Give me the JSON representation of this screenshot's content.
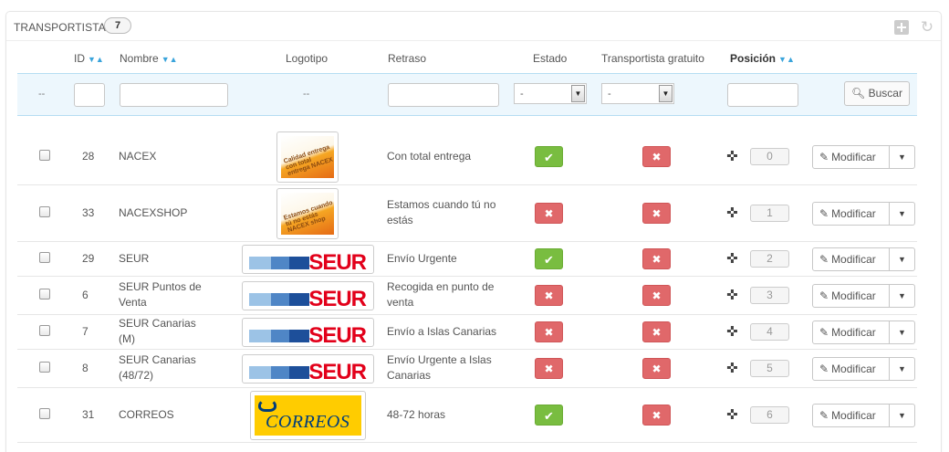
{
  "panel": {
    "title": "TRANSPORTISTAS",
    "count": "7"
  },
  "columns": {
    "id": "ID",
    "name": "Nombre",
    "logo": "Logotipo",
    "delay": "Retraso",
    "status": "Estado",
    "free": "Transportista gratuito",
    "position": "Posición"
  },
  "filters": {
    "select_empty": "--",
    "logo_empty": "--",
    "status_value": "-",
    "free_value": "-",
    "search_label": "Buscar"
  },
  "actions": {
    "edit_label": "Modificar"
  },
  "colors": {
    "enabled": "#79bd40",
    "disabled": "#e0686a",
    "accent": "#3aa4db"
  },
  "rows": [
    {
      "id": "28",
      "name": "NACEX",
      "logo": "nacex",
      "delay": "Con total entrega",
      "active": true,
      "free": false,
      "position": "0"
    },
    {
      "id": "33",
      "name": "NACEXSHOP",
      "logo": "nacexshop",
      "delay": "Estamos cuando tú no estás",
      "active": false,
      "free": false,
      "position": "1"
    },
    {
      "id": "29",
      "name": "SEUR",
      "logo": "seur",
      "delay": "Envío Urgente",
      "active": true,
      "free": false,
      "position": "2"
    },
    {
      "id": "6",
      "name": "SEUR Puntos de Venta",
      "logo": "seur",
      "delay": "Recogida en punto de venta",
      "active": false,
      "free": false,
      "position": "3"
    },
    {
      "id": "7",
      "name": "SEUR Canarias (M)",
      "logo": "seur",
      "delay": "Envío a Islas Canarias",
      "active": false,
      "free": false,
      "position": "4"
    },
    {
      "id": "8",
      "name": "SEUR Canarias (48/72)",
      "logo": "seur",
      "delay": "Envío Urgente a Islas Canarias",
      "active": false,
      "free": false,
      "position": "5"
    },
    {
      "id": "31",
      "name": "CORREOS",
      "logo": "correos",
      "delay": "48-72 horas",
      "active": true,
      "free": false,
      "position": "6"
    }
  ],
  "logo_texts": {
    "seur": "SEUR",
    "correos": "CORREOS",
    "nacex": "Calidad entrega con total entrega NACEX",
    "nacexshop": "Estamos cuando tú no estás NACEX shop"
  }
}
